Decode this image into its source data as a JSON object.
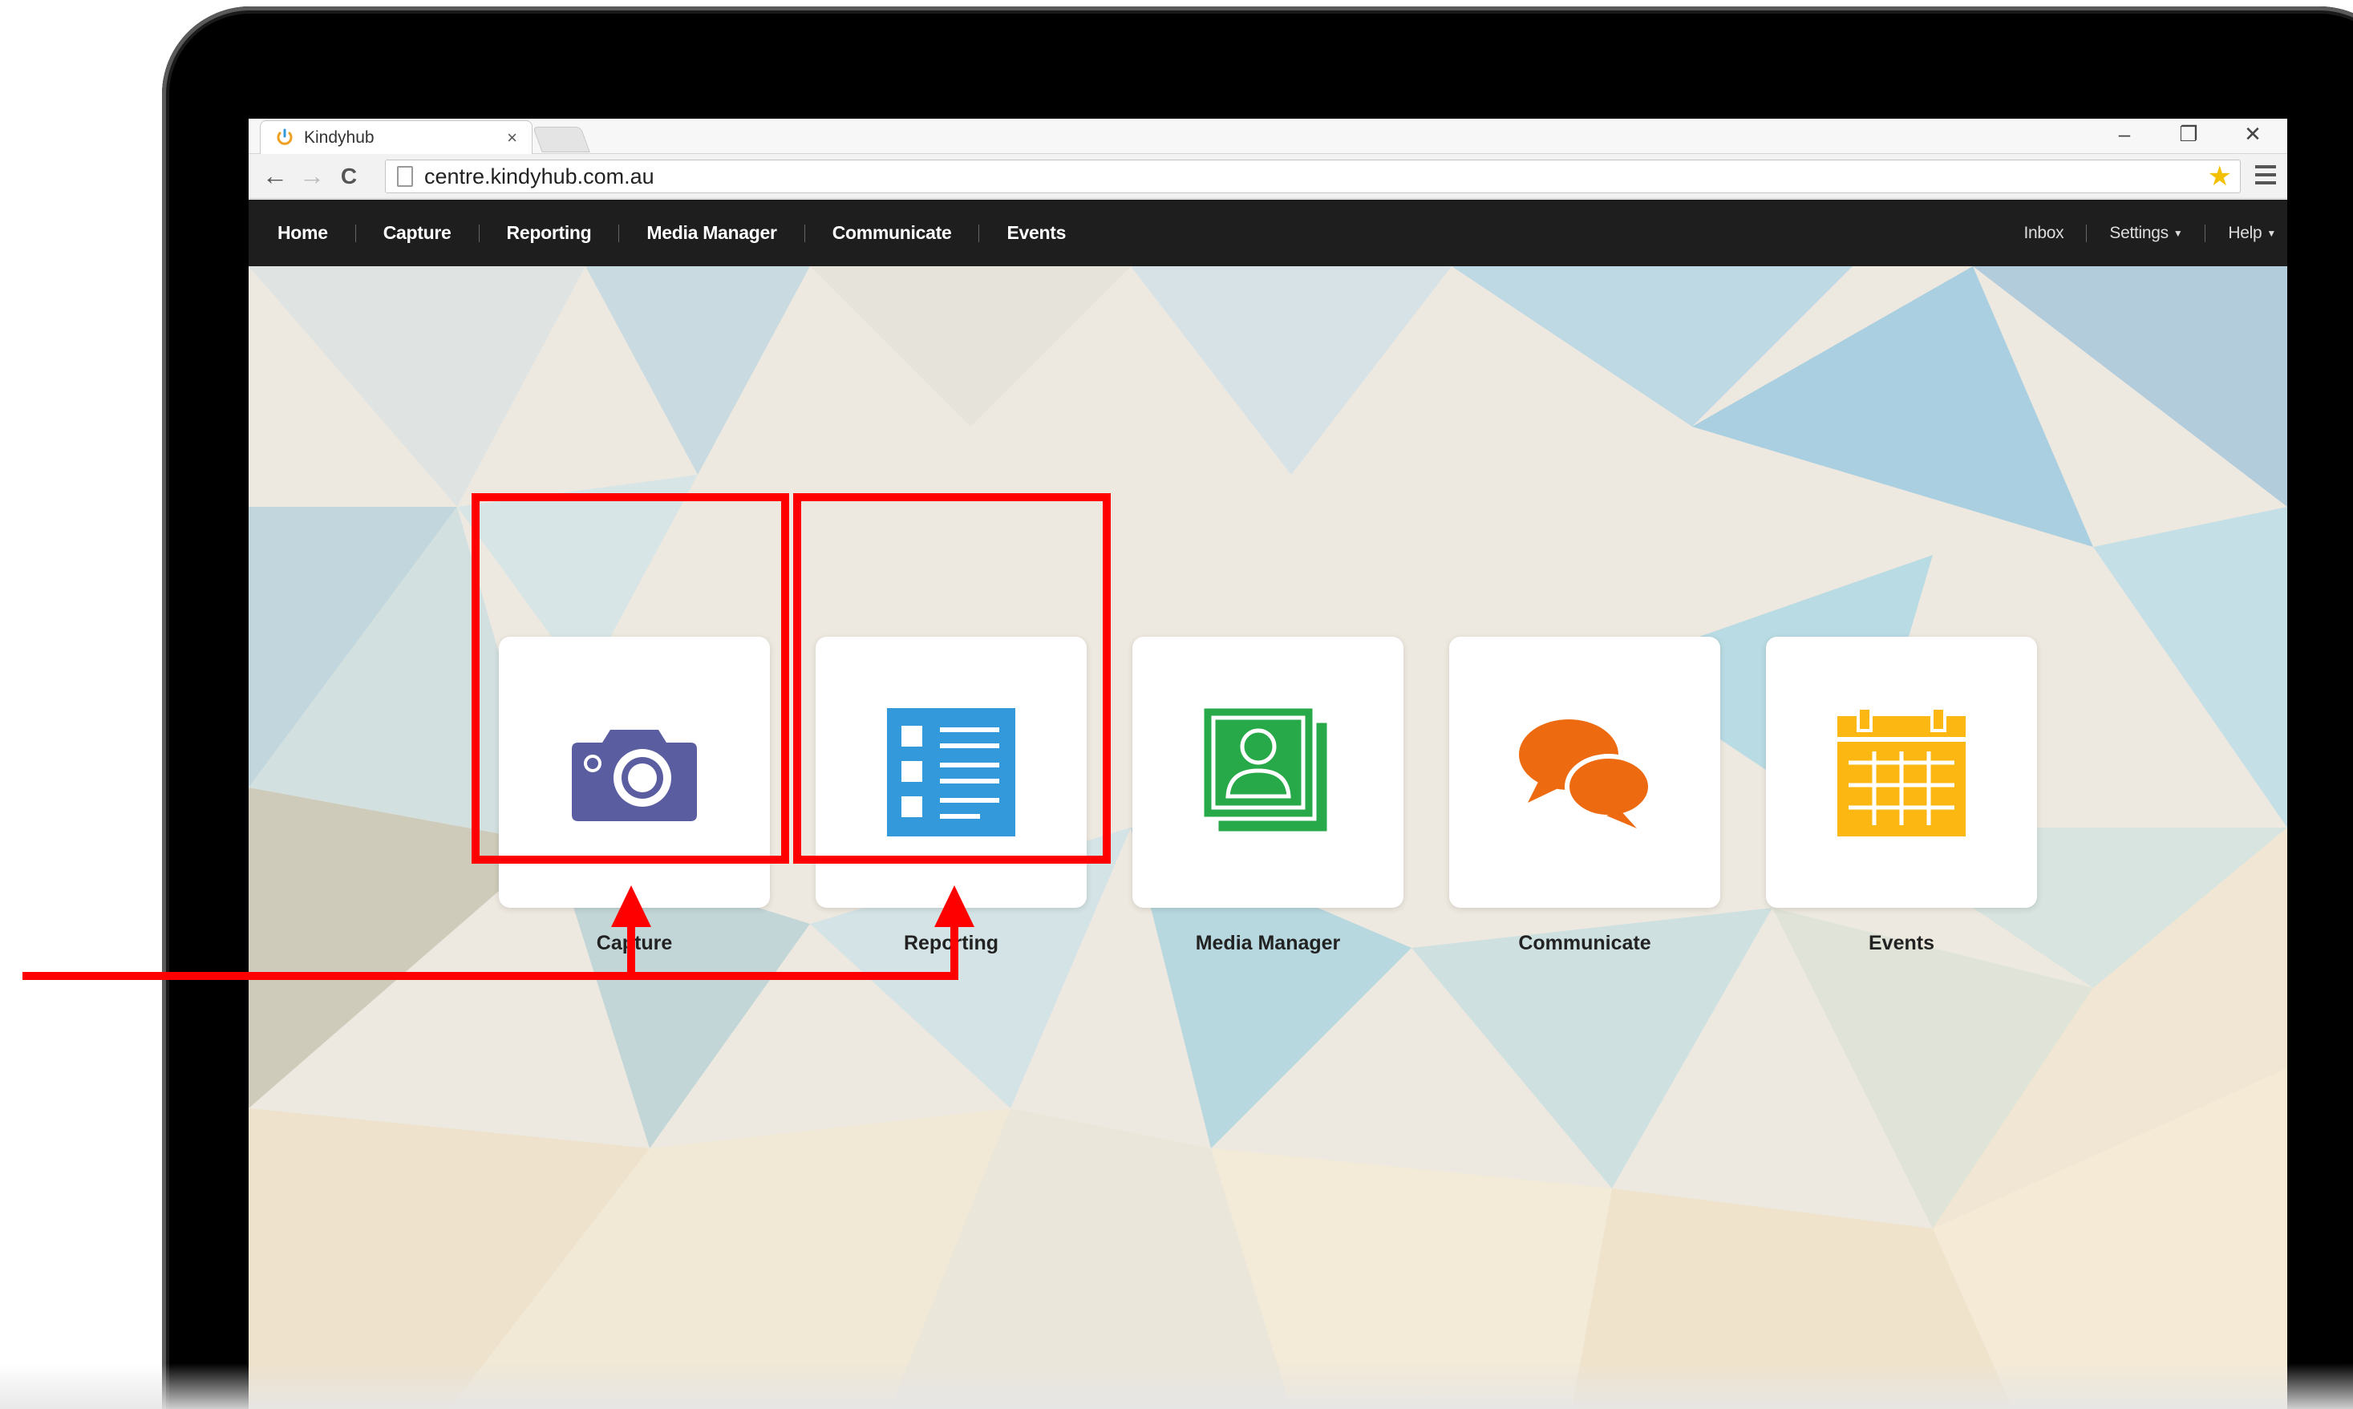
{
  "browser": {
    "tab_title": "Kindyhub",
    "tab_close": "×",
    "url": "centre.kindyhub.com.au",
    "back": "←",
    "forward": "→",
    "reload": "C",
    "star": "★",
    "win_minimize": "–",
    "win_restore": "❐",
    "win_close": "✕"
  },
  "nav": {
    "left": [
      "Home",
      "Capture",
      "Reporting",
      "Media Manager",
      "Communicate",
      "Events"
    ],
    "inbox": "Inbox",
    "settings": "Settings",
    "help": "Help"
  },
  "tiles": [
    {
      "label": "Capture",
      "icon": "camera-icon",
      "color": "#5b5da1"
    },
    {
      "label": "Reporting",
      "icon": "report-list-icon",
      "color": "#3399db"
    },
    {
      "label": "Media Manager",
      "icon": "contact-card-icon",
      "color": "#28a949"
    },
    {
      "label": "Communicate",
      "icon": "chat-bubbles-icon",
      "color": "#ee6a10"
    },
    {
      "label": "Events",
      "icon": "calendar-icon",
      "color": "#fcb713"
    }
  ],
  "annotation": {
    "color": "#ff0000",
    "highlighted": [
      "Capture",
      "Reporting"
    ]
  }
}
